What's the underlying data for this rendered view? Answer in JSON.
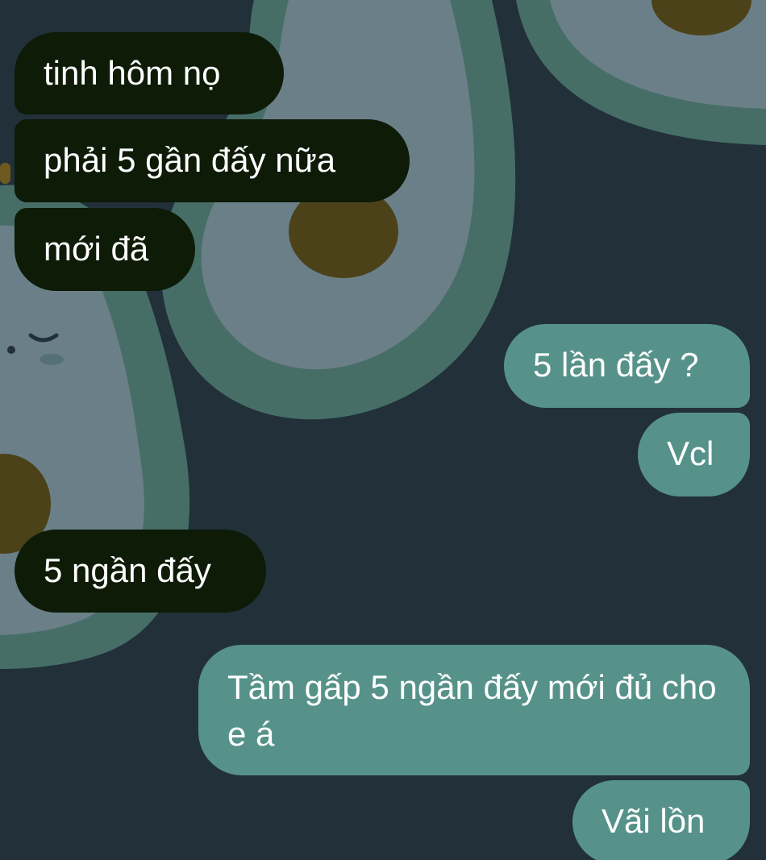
{
  "theme": {
    "background": "#22303a",
    "incoming_bubble": "#0d1b07",
    "outgoing_bubble": "#56928a",
    "text": "#ffffff",
    "avocado_ring": "#466e66",
    "avocado_flesh": "#6b7f88",
    "avocado_pit": "#4b4219"
  },
  "wallpaper": {
    "icons": [
      "avocado-icon",
      "avocado-icon",
      "avocado-icon"
    ]
  },
  "chat": {
    "messages": [
      {
        "from": "other",
        "text": "tinh hôm nọ"
      },
      {
        "from": "other",
        "text": "phải 5 gần đấy nữa"
      },
      {
        "from": "other",
        "text": "mới đã"
      },
      {
        "from": "me",
        "text": "5 lần đấy ?"
      },
      {
        "from": "me",
        "text": "Vcl"
      },
      {
        "from": "other",
        "text": "5 ngần đấy"
      },
      {
        "from": "me",
        "text": "Tầm gấp 5 ngần đấy mới đủ cho e á"
      },
      {
        "from": "me",
        "text": "Vãi lồn"
      }
    ]
  }
}
